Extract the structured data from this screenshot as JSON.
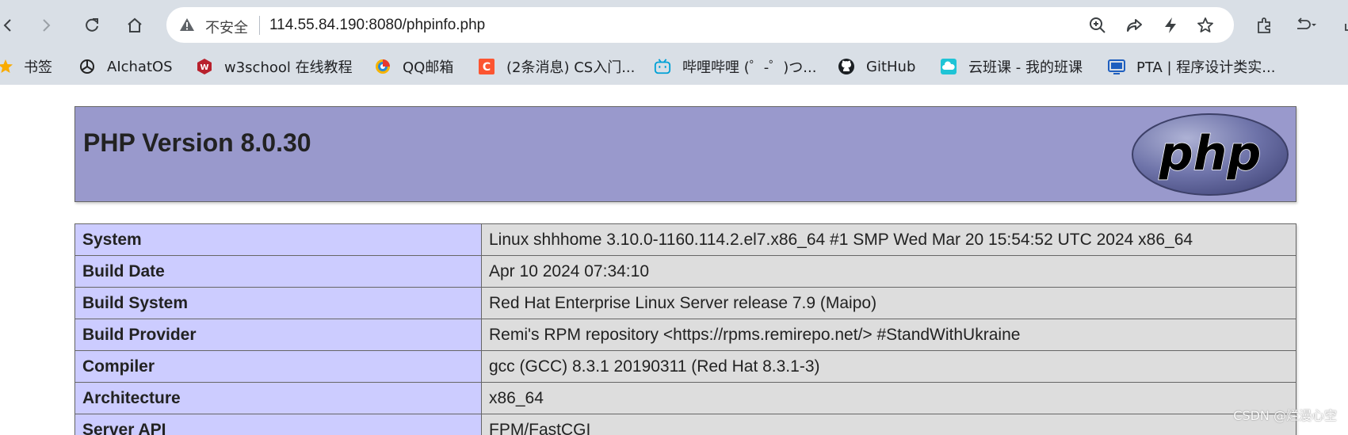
{
  "browser": {
    "security_label": "不安全",
    "url": "114.55.84.190:8080/phpinfo.php"
  },
  "bookmarks": [
    {
      "label": "书签",
      "icon": "star-icon"
    },
    {
      "label": "AIchatOS",
      "icon": "openai-icon"
    },
    {
      "label": "w3school 在线教程",
      "icon": "w3school-icon"
    },
    {
      "label": "QQ邮箱",
      "icon": "qqmail-icon"
    },
    {
      "label": "(2条消息) CS入门...",
      "icon": "csdn-icon"
    },
    {
      "label": "哔哩哔哩 (゜-゜)つ...",
      "icon": "bilibili-icon"
    },
    {
      "label": "GitHub",
      "icon": "github-icon"
    },
    {
      "label": "云班课 - 我的班课",
      "icon": "cloud-class-icon"
    },
    {
      "label": "PTA | 程序设计类实...",
      "icon": "pta-icon"
    }
  ],
  "page": {
    "title": "PHP Version 8.0.30",
    "logo_text": "php",
    "rows": [
      {
        "key": "System",
        "value": "Linux shhhome 3.10.0-1160.114.2.el7.x86_64 #1 SMP Wed Mar 20 15:54:52 UTC 2024 x86_64"
      },
      {
        "key": "Build Date",
        "value": "Apr 10 2024 07:34:10"
      },
      {
        "key": "Build System",
        "value": "Red Hat Enterprise Linux Server release 7.9 (Maipo)"
      },
      {
        "key": "Build Provider",
        "value": "Remi's RPM repository <https://rpms.remirepo.net/> #StandWithUkraine"
      },
      {
        "key": "Compiler",
        "value": "gcc (GCC) 8.3.1 20190311 (Red Hat 8.3.1-3)"
      },
      {
        "key": "Architecture",
        "value": "x86_64"
      },
      {
        "key": "Server API",
        "value": "FPM/FastCGI"
      }
    ]
  },
  "watermark": "CSDN @烂漫心空",
  "colors": {
    "header_bg": "#9999cc",
    "key_cell_bg": "#ccccff",
    "value_cell_bg": "#dddddd",
    "chrome_bg": "#d9dfe6"
  }
}
